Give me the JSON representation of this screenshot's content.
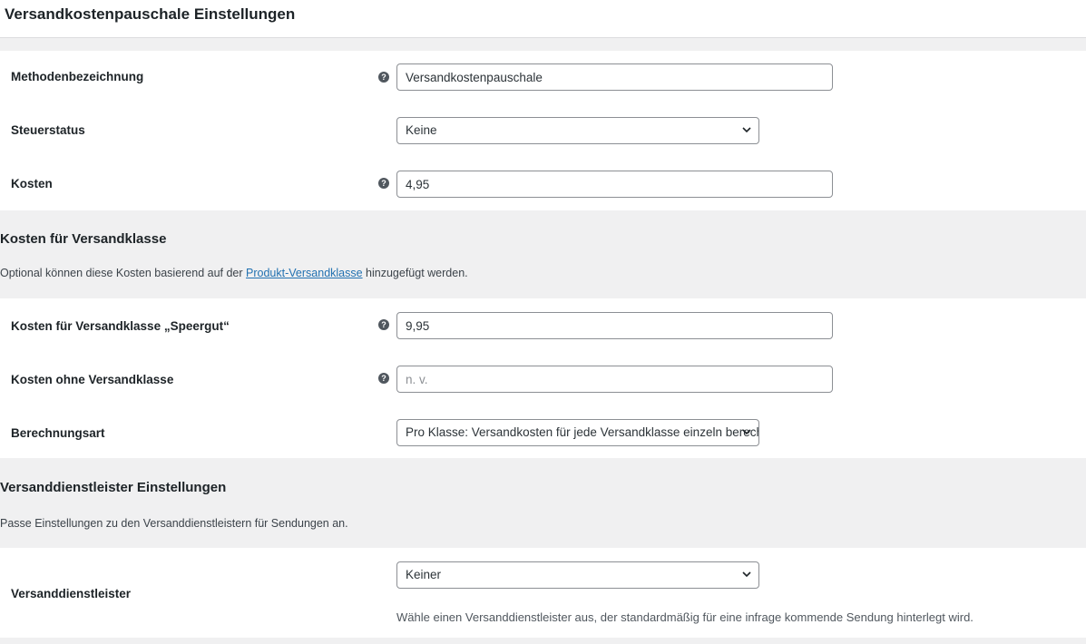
{
  "page": {
    "title": "Versandkostenpauschale Einstellungen"
  },
  "general": {
    "method_title": {
      "label": "Methodenbezeichnung",
      "value": "Versandkostenpauschale"
    },
    "tax_status": {
      "label": "Steuerstatus",
      "value": "Keine"
    },
    "cost": {
      "label": "Kosten",
      "value": "4,95"
    }
  },
  "class_costs": {
    "heading": "Kosten für Versandklasse",
    "desc_prefix": "Optional können diese Kosten basierend auf der ",
    "desc_link": "Produkt-Versandklasse",
    "desc_suffix": " hinzugefügt werden.",
    "speergut": {
      "label": "Kosten für Versandklasse „Speergut“",
      "value": "9,95"
    },
    "no_class": {
      "label": "Kosten ohne Versandklasse",
      "placeholder": "n. v."
    },
    "calc_type": {
      "label": "Berechnungsart",
      "value": "Pro Klasse: Versandkosten für jede Versandklasse einzeln berechnen"
    }
  },
  "provider": {
    "heading": "Versanddienstleister Einstellungen",
    "desc": "Passe Einstellungen zu den Versanddienstleistern für Sendungen an.",
    "field": {
      "label": "Versanddienstleister",
      "value": "Keiner",
      "help": "Wähle einen Versanddienstleister aus, der standardmäßig für eine infrage kommende Sendung hinterlegt wird."
    }
  },
  "icons": {
    "help": "question-mark-circle-icon",
    "dropdown": "chevron-down-icon"
  },
  "colors": {
    "link": "#2271b1",
    "background": "#f0f0f1",
    "panel": "#ffffff"
  }
}
